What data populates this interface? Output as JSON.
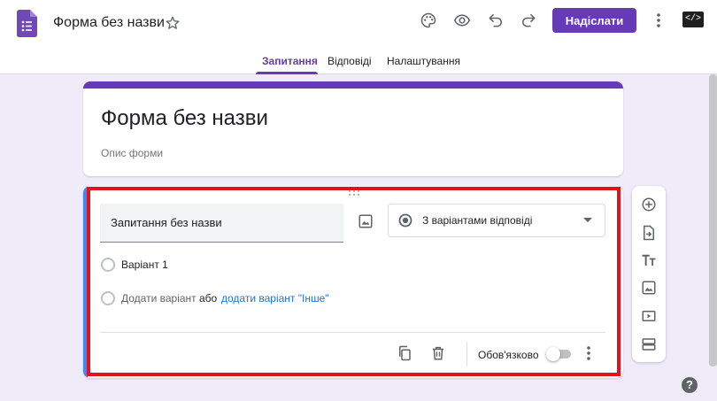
{
  "header": {
    "doc_title": "Форма без назви",
    "send_label": "Надіслати",
    "code_glyph": "</>",
    "accent": "#673ab7"
  },
  "icons": {
    "app": "forms-logo-icon",
    "star": "star-icon",
    "palette": "palette-icon",
    "preview": "eye-icon",
    "undo": "undo-icon",
    "redo": "redo-icon",
    "more": "more-vert-icon",
    "code": "code-icon",
    "help": "help-icon"
  },
  "tabs": [
    {
      "label": "Запитання",
      "active": true
    },
    {
      "label": "Відповіді",
      "active": false
    },
    {
      "label": "Налаштування",
      "active": false
    }
  ],
  "form": {
    "title": "Форма без назви",
    "description_placeholder": "Опис форми"
  },
  "question": {
    "title_placeholder": "Запитання без назви",
    "type_label": "З варіантами відповіді",
    "option1": "Варіант 1",
    "add_option": "Додати варіант",
    "or_text": "або",
    "add_other": "додати варіант \"Інше\"",
    "required_label": "Обов'язково",
    "required": false,
    "link_color": "#1a73e8",
    "highlight_color": "#e0121d"
  },
  "side_toolbar": [
    "add-question-icon",
    "import-questions-icon",
    "add-title-icon",
    "add-image-icon",
    "add-video-icon",
    "add-section-icon"
  ],
  "help_glyph": "?"
}
